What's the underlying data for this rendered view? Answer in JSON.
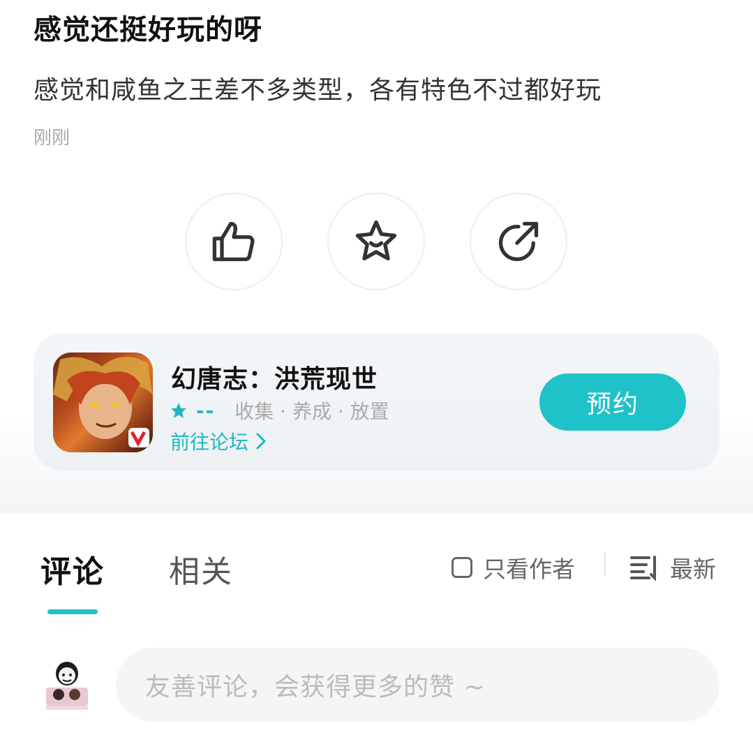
{
  "post": {
    "title": "感觉还挺好玩的呀",
    "body": "感觉和咸鱼之王差不多类型，各有特色不过都好玩",
    "time": "刚刚"
  },
  "actions": [
    {
      "name": "like",
      "icon": "thumbs-up-icon"
    },
    {
      "name": "favorite",
      "icon": "star-icon"
    },
    {
      "name": "share",
      "icon": "share-icon"
    }
  ],
  "game_card": {
    "name": "幻唐志：洪荒现世",
    "rating": "--",
    "tags": "收集 · 养成 · 放置",
    "forum_link": "前往论坛",
    "reserve_label": "预约",
    "accent_color": "#1fc2c9"
  },
  "tabs": {
    "comments_label": "评论",
    "related_label": "相关",
    "author_only_label": "只看作者",
    "sort_label": "最新"
  },
  "comment_box": {
    "placeholder": "友善评论，会获得更多的赞 ~"
  }
}
